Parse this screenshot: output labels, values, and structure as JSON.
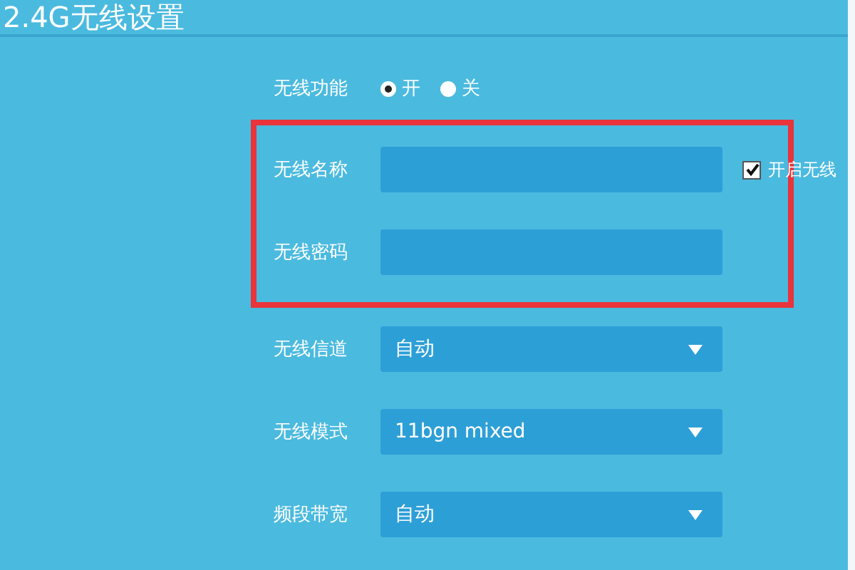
{
  "title": "2.4G无线设置",
  "wireless_function": {
    "label": "无线功能",
    "options": [
      {
        "label": "开",
        "selected": true
      },
      {
        "label": "关",
        "selected": false
      }
    ]
  },
  "highlighted_fields": [
    {
      "label": "无线名称"
    },
    {
      "label": "无线密码"
    }
  ],
  "broadcast": {
    "label": "开启无线",
    "checked": true
  },
  "selects": [
    {
      "label": "无线信道",
      "value": "自动"
    },
    {
      "label": "无线模式",
      "value": "11bgn mixed"
    },
    {
      "label": "频段带宽",
      "value": "自动"
    }
  ]
}
